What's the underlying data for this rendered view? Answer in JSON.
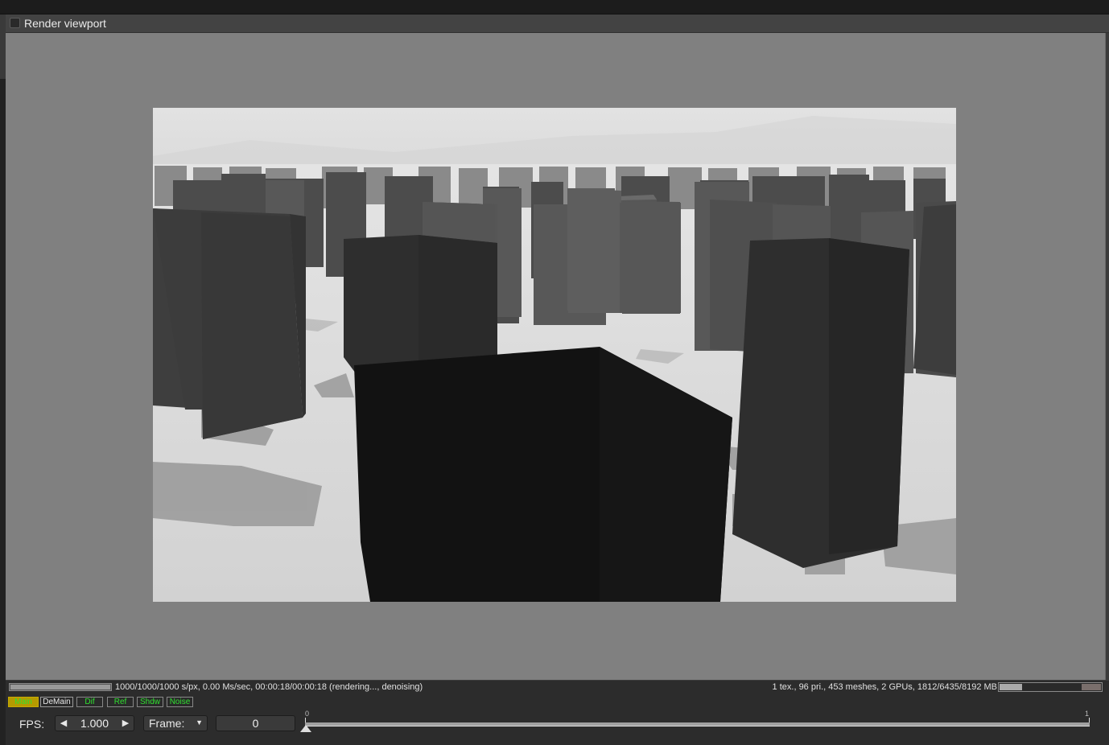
{
  "window": {
    "title": "Render viewport"
  },
  "status": {
    "progress_fraction": 1.0,
    "render_info": "1000/1000/1000 s/px, 0.00 Ms/sec, 00:00:18/00:00:18 (rendering..., denoising)",
    "scene_info": "1 tex., 96 pri., 453 meshes, 2 GPUs, 1812/6435/8192 MB",
    "memory_used_fraction": 0.221,
    "memory_peak_fraction": 0.786
  },
  "passes": [
    {
      "label": "Main",
      "active": true
    },
    {
      "label": "DeMain",
      "active": false
    },
    {
      "label": "Dif",
      "active": false
    },
    {
      "label": "Ref",
      "active": false
    },
    {
      "label": "Shdw",
      "active": false
    },
    {
      "label": "Noise",
      "active": false
    }
  ],
  "controls": {
    "fps_label": "FPS:",
    "fps_value": "1.000",
    "frame_label": "Frame:",
    "frame_value": "0",
    "timeline_start": "0",
    "timeline_end": "1"
  },
  "colors": {
    "pass_active_bg": "#b59a00",
    "pass_text": "#30e030",
    "viewport_bg": "#808080"
  }
}
